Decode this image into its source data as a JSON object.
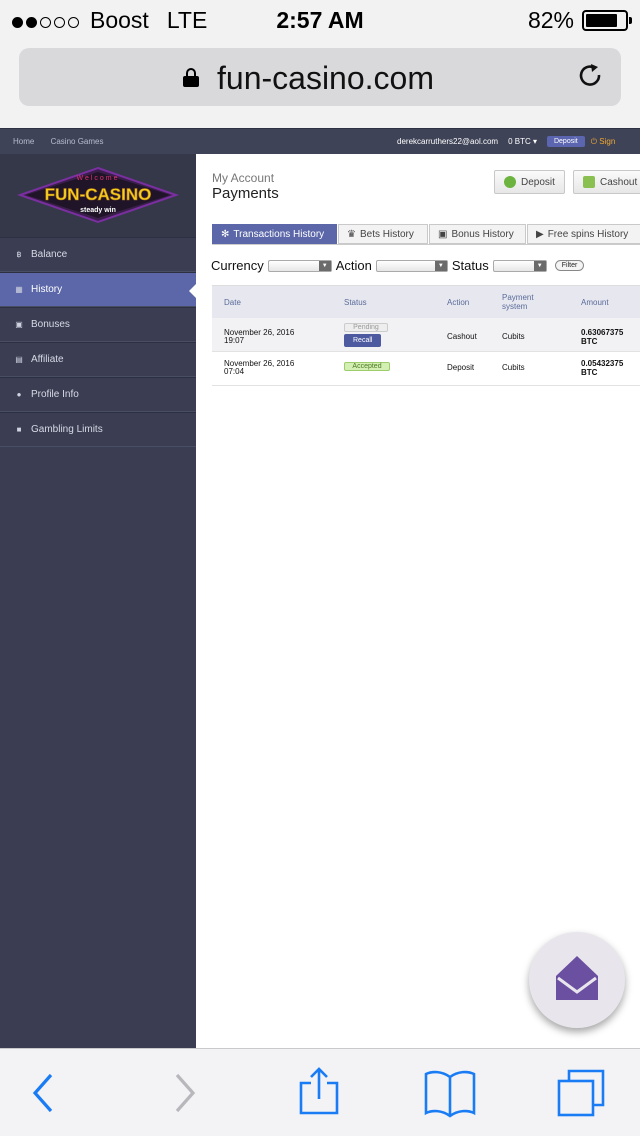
{
  "status_bar": {
    "carrier": "Boost",
    "network": "LTE",
    "time": "2:57 AM",
    "battery": "82%",
    "battery_level": 0.82,
    "signal_bars": 2
  },
  "browser": {
    "url": "fun-casino.com"
  },
  "topnav": {
    "links": [
      "Home",
      "Casino Games"
    ],
    "email": "derekcarruthers22@aol.com",
    "balance": "0 BTC",
    "deposit": "Deposit",
    "sign": "Sign"
  },
  "logo": {
    "top": "Welcome",
    "main": "FUN-CASINO",
    "sub": "steady win"
  },
  "sidebar": {
    "items": [
      {
        "label": "Balance",
        "icon": "bitcoin-icon"
      },
      {
        "label": "History",
        "icon": "calendar-icon",
        "active": true
      },
      {
        "label": "Bonuses",
        "icon": "gift-icon"
      },
      {
        "label": "Affiliate",
        "icon": "briefcase-icon"
      },
      {
        "label": "Profile Info",
        "icon": "info-icon"
      },
      {
        "label": "Gambling Limits",
        "icon": "lock-icon"
      }
    ]
  },
  "main": {
    "breadcrumb": "My Account",
    "title": "Payments",
    "deposit_button": "Deposit",
    "cashout_button": "Cashout",
    "tabs": [
      {
        "label": "Transactions History",
        "active": true
      },
      {
        "label": "Bets History"
      },
      {
        "label": "Bonus History"
      },
      {
        "label": "Free spins History"
      }
    ],
    "filters": {
      "currency": "Currency",
      "action": "Action",
      "status": "Status",
      "filter_button": "Filter"
    },
    "table": {
      "headers": {
        "date": "Date",
        "status": "Status",
        "action": "Action",
        "payment_system_1": "Payment",
        "payment_system_2": "system",
        "amount": "Amount"
      },
      "rows": [
        {
          "date": "November 26, 2016",
          "time": "19:07",
          "status": "Pending",
          "recall": "Recall",
          "action": "Cashout",
          "system": "Cubits",
          "amount": "0.63067375",
          "currency": "BTC"
        },
        {
          "date": "November 26, 2016",
          "time": "07:04",
          "status": "Accepted",
          "action": "Deposit",
          "system": "Cubits",
          "amount": "0.05432375",
          "currency": "BTC"
        }
      ]
    }
  },
  "colors": {
    "sidebar": "#3b3e52",
    "accent": "#5b67a8",
    "chat_button": "#6b4fa0"
  }
}
